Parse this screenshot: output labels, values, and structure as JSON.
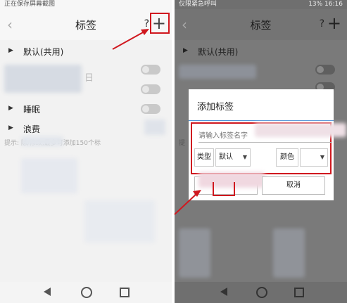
{
  "left_screen": {
    "status_text": "正在保存屏幕截图",
    "title": "标签",
    "help": "?",
    "add": "+",
    "rows": [
      {
        "label": "默认(共用)"
      },
      {
        "label": "睡眠"
      },
      {
        "label": "浪费"
      }
    ],
    "partial_label": "日",
    "hint": "提示:            除/修改,最多可添加150个标"
  },
  "right_screen": {
    "status_left": "仅限紧急呼叫",
    "status_right": "13% 16:16",
    "title": "标签",
    "help": "?",
    "add": "+",
    "rows": [
      {
        "label": "默认(共用)"
      }
    ],
    "hint": "提",
    "dialog": {
      "title": "添加标签",
      "input_placeholder": "请输入标签名字",
      "type_label": "类型",
      "type_value": "默认",
      "color_label": "颜色",
      "cancel_label": "取消"
    }
  },
  "colors": {
    "highlight": "#d0181f",
    "dialog_separator": "#4b92d6"
  },
  "icons": [
    "back-icon",
    "add-icon",
    "help-icon",
    "caret-right-icon",
    "nav-back-icon",
    "nav-home-icon",
    "nav-recent-icon",
    "dropdown-arrow-icon"
  ]
}
